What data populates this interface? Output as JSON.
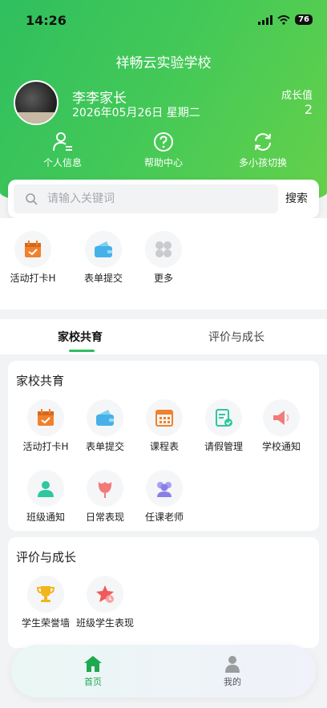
{
  "status_bar": {
    "time": "14:26",
    "battery": "76"
  },
  "header": {
    "school_name": "祥畅云实验学校",
    "user_name": "李李家长",
    "date": "2026年05月26日 星期二",
    "growth_label": "成长值",
    "growth_value": "2",
    "quick_actions": [
      {
        "label": "个人信息",
        "icon": "person-list-icon"
      },
      {
        "label": "帮助中心",
        "icon": "question-circle-icon"
      },
      {
        "label": "多小孩切换",
        "icon": "refresh-icon"
      }
    ]
  },
  "search": {
    "placeholder": "请输入关键词",
    "button": "搜索"
  },
  "top_apps": [
    {
      "label": "活动打卡H",
      "icon": "calendar-check-icon",
      "color": "#f0812d"
    },
    {
      "label": "表单提交",
      "icon": "wallet-icon",
      "color": "#46b1e9"
    },
    {
      "label": "更多",
      "icon": "grid-more-icon",
      "color": "#c9cbcf"
    }
  ],
  "tabs": {
    "active": "家校共育",
    "other": "评价与成长"
  },
  "home_school": {
    "title": "家校共育",
    "items": [
      {
        "label": "活动打卡H",
        "icon": "calendar-check-icon",
        "color": "#f0812d"
      },
      {
        "label": "表单提交",
        "icon": "wallet-icon",
        "color": "#46b1e9"
      },
      {
        "label": "课程表",
        "icon": "calendar-grid-icon",
        "color": "#f0812d"
      },
      {
        "label": "请假管理",
        "icon": "leave-form-icon",
        "color": "#2ec7a0"
      },
      {
        "label": "学校通知",
        "icon": "megaphone-icon",
        "color": "#f37a7a"
      },
      {
        "label": "班级通知",
        "icon": "class-notice-icon",
        "color": "#2ec7a0"
      },
      {
        "label": "日常表现",
        "icon": "tulip-icon",
        "color": "#f37a7a"
      },
      {
        "label": "任课老师",
        "icon": "teachers-icon",
        "color": "#8a7fe8"
      }
    ]
  },
  "evaluation": {
    "title": "评价与成长",
    "items": [
      {
        "label": "学生荣誉墙",
        "icon": "trophy-icon",
        "color": "#f2b51c"
      },
      {
        "label": "班级学生表现",
        "icon": "star-badge-icon",
        "color": "#f05a5a"
      }
    ]
  },
  "bottom_nav": [
    {
      "label": "首页",
      "icon": "home-icon",
      "active": true,
      "color": "#1fa94f"
    },
    {
      "label": "我的",
      "icon": "user-icon",
      "active": false,
      "color": "#555555"
    }
  ]
}
